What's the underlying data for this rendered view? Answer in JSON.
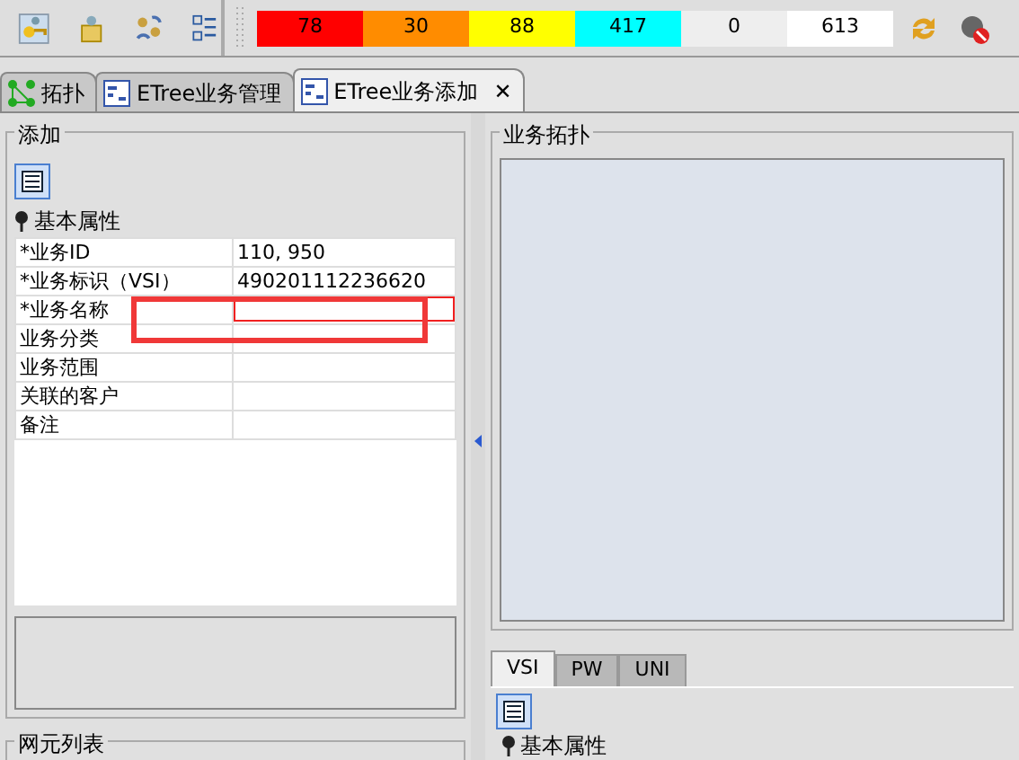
{
  "toolbar": {
    "counters": [
      {
        "value": "78",
        "color": "#ff0000"
      },
      {
        "value": "30",
        "color": "#ff8c00"
      },
      {
        "value": "88",
        "color": "#ffff00"
      },
      {
        "value": "417",
        "color": "#00ffff"
      },
      {
        "value": "0",
        "color": "#eeeeee"
      },
      {
        "value": "613",
        "color": "#ffffff"
      }
    ]
  },
  "tabs": [
    {
      "label": "拓扑",
      "selected": false
    },
    {
      "label": "ETree业务管理",
      "selected": false
    },
    {
      "label": "ETree业务添加",
      "selected": true,
      "close": "✕"
    }
  ],
  "add_panel": {
    "title": "添加",
    "section": "基本属性",
    "fields": [
      {
        "label": "*业务ID",
        "value": "110, 950",
        "kind": "text"
      },
      {
        "label": "*业务标识（VSI）",
        "value": "490201112236620",
        "kind": "text"
      },
      {
        "label": "*业务名称",
        "kind": "input"
      },
      {
        "label": "业务分类",
        "kind": "text"
      },
      {
        "label": "业务范围",
        "kind": "text"
      },
      {
        "label": "关联的客户",
        "kind": "text"
      },
      {
        "label": "备注",
        "kind": "text"
      }
    ]
  },
  "list_panel": {
    "title": "网元列表"
  },
  "topology_panel": {
    "title": "业务拓扑"
  },
  "detail_tabs": [
    {
      "label": "VSI",
      "selected": true
    },
    {
      "label": "PW",
      "selected": false
    },
    {
      "label": "UNI",
      "selected": false
    }
  ],
  "detail_section": "基本属性"
}
